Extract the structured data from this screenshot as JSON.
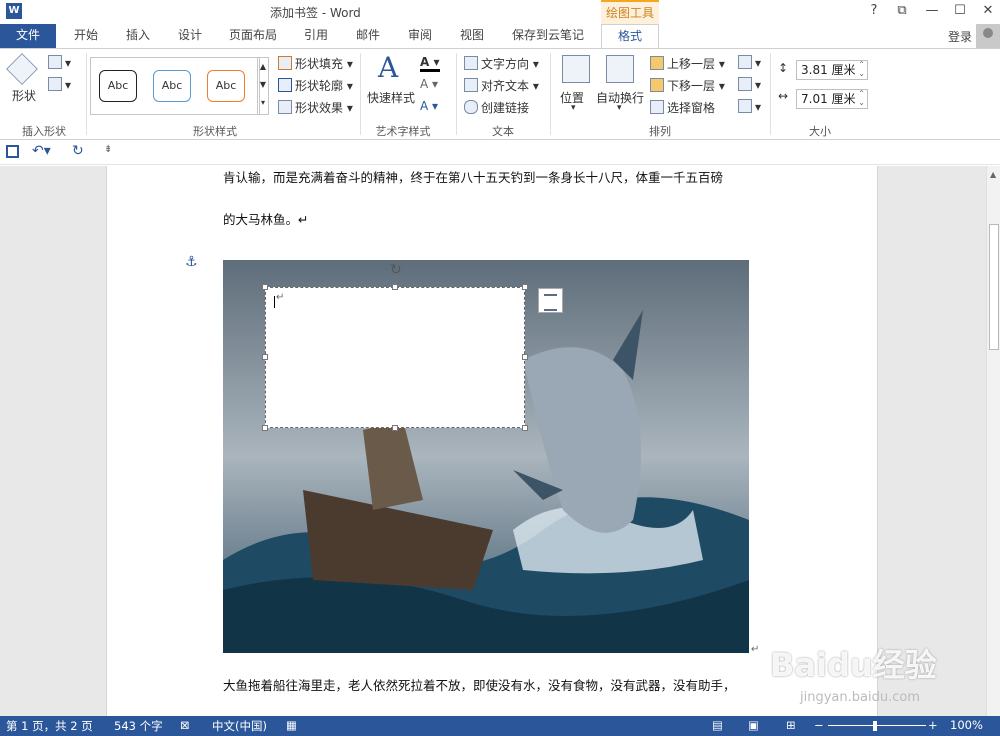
{
  "window": {
    "title": "添加书签 - Word",
    "context_tab_group": "绘图工具",
    "help": "?",
    "restore": "⧉",
    "minimize": "—",
    "maximize": "☐",
    "close": "✕"
  },
  "tabs": [
    {
      "label": "文件"
    },
    {
      "label": "开始"
    },
    {
      "label": "插入"
    },
    {
      "label": "设计"
    },
    {
      "label": "页面布局"
    },
    {
      "label": "引用"
    },
    {
      "label": "邮件"
    },
    {
      "label": "审阅"
    },
    {
      "label": "视图"
    },
    {
      "label": "保存到云笔记"
    },
    {
      "label": "格式"
    }
  ],
  "account": {
    "login": "登录"
  },
  "ribbon": {
    "insert_shapes": {
      "shape_label": "形状",
      "group_label": "插入形状"
    },
    "shape_styles": {
      "presets": [
        "Abc",
        "Abc",
        "Abc"
      ],
      "fill": "形状填充",
      "outline": "形状轮廓",
      "effects": "形状效果",
      "group_label": "形状样式"
    },
    "wordart": {
      "quick_styles": "快速样式",
      "group_label": "艺术字样式",
      "glyph": "A"
    },
    "text": {
      "direction": "文字方向",
      "align": "对齐文本",
      "link": "创建链接",
      "group_label": "文本"
    },
    "arrange": {
      "position": "位置",
      "wrap": "自动换行",
      "bring_forward": "上移一层",
      "send_backward": "下移一层",
      "selection_pane": "选择窗格",
      "group_label": "排列"
    },
    "size": {
      "height": "3.81 厘米",
      "width": "7.01 厘米",
      "group_label": "大小"
    }
  },
  "document": {
    "para1": "肯认输，而是充满着奋斗的精神，终于在第八十五天钓到一条身长十八尺，体重一千五百磅",
    "para2": "的大马林鱼。↵",
    "para3": "大鱼拖着船往海里走，老人依然死拉着不放，即使没有水，没有食物，没有武器，没有助手，",
    "textbox_mark": "↵",
    "image_mark": "↵"
  },
  "statusbar": {
    "page": "第 1 页，共 2 页",
    "words": "543 个字",
    "language": "中文(中国)",
    "zoom": "100%",
    "zoom_minus": "−",
    "zoom_plus": "+"
  },
  "watermark": {
    "brand": "Baidu经验",
    "url": "jingyan.baidu.com"
  },
  "colors": {
    "accent": "#2b579a",
    "context": "#d0811f"
  }
}
